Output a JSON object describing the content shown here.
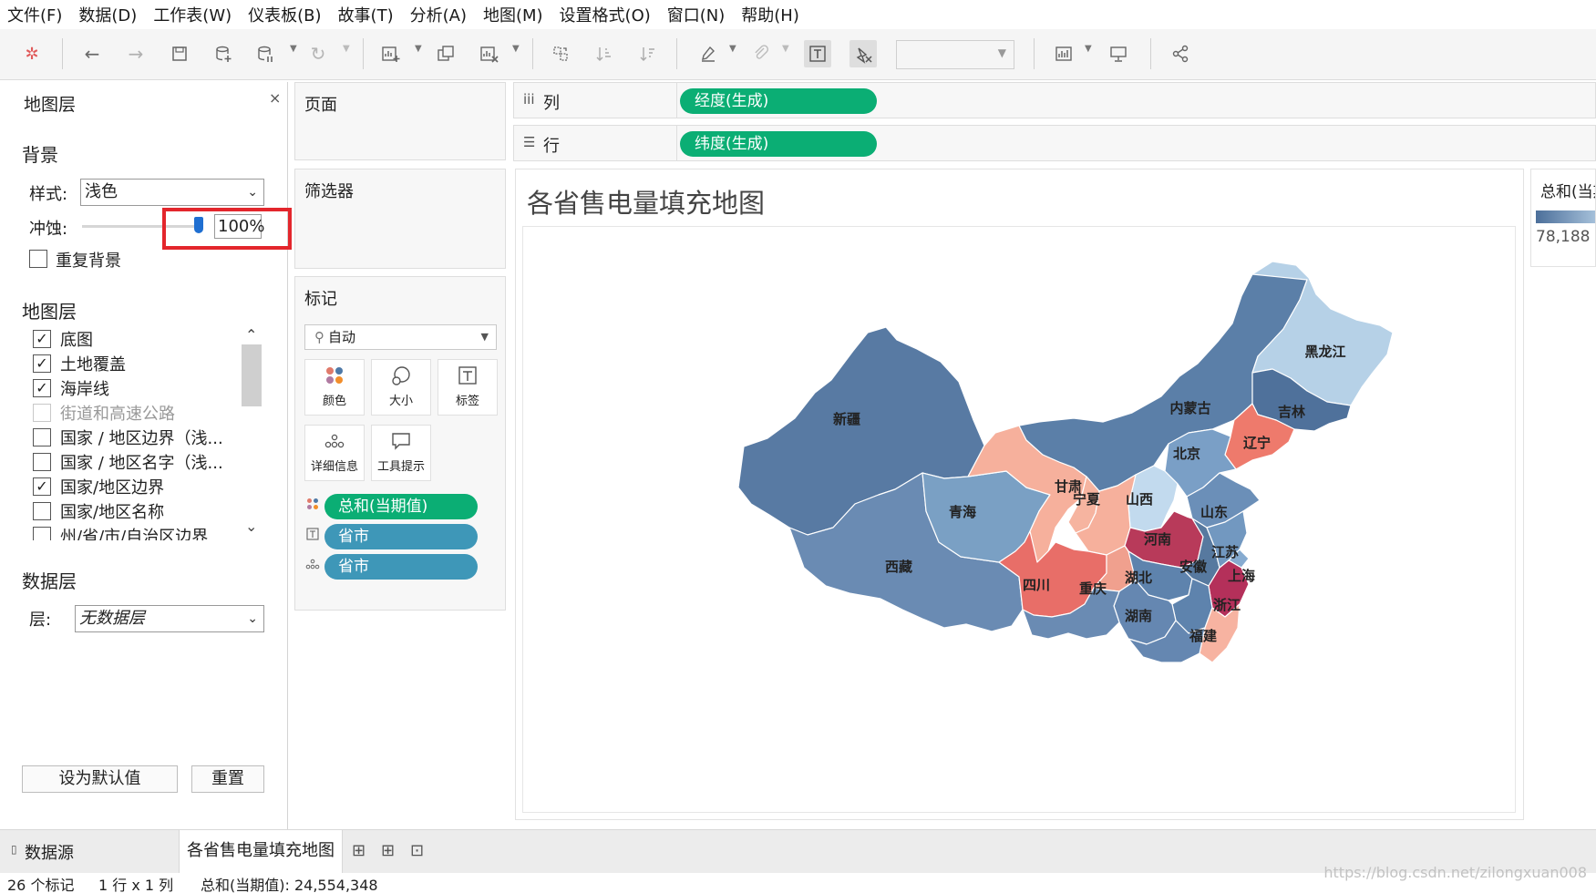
{
  "menu": [
    "文件(F)",
    "数据(D)",
    "工作表(W)",
    "仪表板(B)",
    "故事(T)",
    "分析(A)",
    "地图(M)",
    "设置格式(O)",
    "窗口(N)",
    "帮助(H)"
  ],
  "toolbar": {
    "icons": [
      "tableau-logo-icon",
      "undo-icon",
      "redo-icon",
      "save-icon",
      "new-datasource-icon",
      "pause-update-icon",
      "refresh-icon",
      "new-worksheet-icon",
      "duplicate-icon",
      "clear-sheet-icon",
      "swap-icon",
      "sort-ascending-icon",
      "sort-descending-icon",
      "highlight-icon",
      "group-icon",
      "show-labels-icon",
      "fix-axes-icon",
      "show-me-icon",
      "presentation-icon",
      "share-icon"
    ]
  },
  "map_layers_panel": {
    "title": "地图层",
    "close": "×",
    "background_header": "背景",
    "style_label": "样式:",
    "style_value": "浅色",
    "wash_label": "冲蚀:",
    "wash_value": "100%",
    "wash_level": 1.0,
    "repeat_background_label": "重复背景",
    "repeat_background_checked": false,
    "layers_header": "地图层",
    "layers": [
      {
        "label": "底图",
        "checked": true,
        "disabled": false
      },
      {
        "label": "土地覆盖",
        "checked": true,
        "disabled": false
      },
      {
        "label": "海岸线",
        "checked": true,
        "disabled": false
      },
      {
        "label": "街道和高速公路",
        "checked": false,
        "disabled": true
      },
      {
        "label": "国家 / 地区边界（浅...",
        "checked": false,
        "disabled": false
      },
      {
        "label": "国家 / 地区名字（浅...",
        "checked": false,
        "disabled": false
      },
      {
        "label": "国家/地区边界",
        "checked": true,
        "disabled": false
      },
      {
        "label": "国家/地区名称",
        "checked": false,
        "disabled": false
      },
      {
        "label": "州/省/市/自治区边界",
        "checked": false,
        "disabled": false
      }
    ],
    "data_layer_header": "数据层",
    "layer_label": "层:",
    "layer_value": "无数据层",
    "set_default_button": "设为默认值",
    "reset_button": "重置"
  },
  "pages_card": {
    "title": "页面"
  },
  "filters_card": {
    "title": "筛选器"
  },
  "marks_card": {
    "title": "标记",
    "type": "自动",
    "buttons": [
      {
        "label": "颜色",
        "icon": "color-dots-icon"
      },
      {
        "label": "大小",
        "icon": "size-icon"
      },
      {
        "label": "标签",
        "icon": "label-icon"
      },
      {
        "label": "详细信息",
        "icon": "detail-icon"
      },
      {
        "label": "工具提示",
        "icon": "tooltip-icon"
      }
    ],
    "pills": [
      {
        "icon": "color-dots-icon",
        "label": "总和(当期值)",
        "color": "#0bae74"
      },
      {
        "icon": "label-icon",
        "label": "省市",
        "color": "#3e97b8"
      },
      {
        "icon": "detail-icon",
        "label": "省市",
        "color": "#3e97b8"
      }
    ]
  },
  "columns_shelf": {
    "label": "列",
    "pill": "经度(生成)"
  },
  "rows_shelf": {
    "label": "行",
    "pill": "纬度(生成)"
  },
  "view": {
    "title": "各省售电量填充地图",
    "provinces": [
      {
        "name": "新疆",
        "color": "#587aa3"
      },
      {
        "name": "西藏",
        "color": "#6a8bb3"
      },
      {
        "name": "青海",
        "color": "#7aa0c4"
      },
      {
        "name": "甘肃",
        "color": "#f6b09c"
      },
      {
        "name": "内蒙古",
        "color": "#5b7fa8"
      },
      {
        "name": "黑龙江",
        "color": "#b6d1e7"
      },
      {
        "name": "吉林",
        "color": "#4f719b"
      },
      {
        "name": "辽宁",
        "color": "#ee7a6c"
      },
      {
        "name": "宁夏",
        "color": "#f6b4a0"
      },
      {
        "name": "北京",
        "color": "#7a9fc6"
      },
      {
        "name": "山西",
        "color": "#c2daee"
      },
      {
        "name": "山东",
        "color": "#6b8fb8"
      },
      {
        "name": "河南",
        "color": "#b83a5a"
      },
      {
        "name": "四川",
        "color": "#e86e68"
      },
      {
        "name": "重庆",
        "color": "#f0a08e"
      },
      {
        "name": "湖北",
        "color": "#5e83ad"
      },
      {
        "name": "安徽",
        "color": "#57799f"
      },
      {
        "name": "江苏",
        "color": "#7298c0"
      },
      {
        "name": "上海",
        "color": "#86abd0"
      },
      {
        "name": "浙江",
        "color": "#b4305a"
      },
      {
        "name": "湖南",
        "color": "#6587b1"
      },
      {
        "name": "福建",
        "color": "#f7b3a1"
      }
    ]
  },
  "legend": {
    "title": "总和(当期值)",
    "value": "78,188"
  },
  "tabs": {
    "datasource": "数据源",
    "sheet": "各省售电量填充地图",
    "controls": [
      "new-worksheet-icon",
      "new-dashboard-icon",
      "new-story-icon"
    ]
  },
  "status": {
    "marks": "26 个标记",
    "rows_cols": "1 行 x 1 列",
    "sum": "总和(当期值): 24,554,348"
  },
  "watermark": "https://blog.csdn.net/zilongxuan008"
}
